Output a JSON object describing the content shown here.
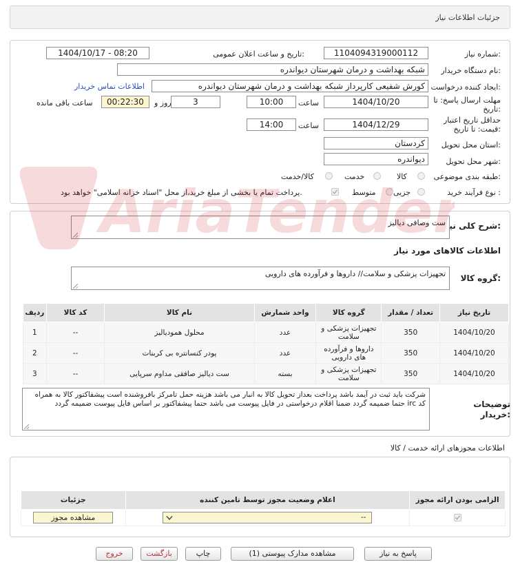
{
  "header": {
    "title": "جزئیات اطلاعات نیاز"
  },
  "form": {
    "need_number_label": "شماره نیاز:",
    "need_number": "1104094319000112",
    "announce_label": "تاریخ و ساعت اعلان عمومی:",
    "announce_value": "1404/10/17 - 08:20",
    "buyer_org_label": "نام دستگاه خریدار:",
    "buyer_org": "شبکه بهداشت و درمان شهرستان دیواندره",
    "requester_label": "ایجاد کننده درخواست:",
    "requester": "کورش شفیعی کارپرداز شبکه بهداشت و درمان شهرستان دیواندره",
    "contact_link": "اطلاعات تماس خریدار",
    "reply_deadline_label_1": "مهلت ارسال پاسخ: تا",
    "reply_deadline_label_2": "تاریخ:",
    "reply_date": "1404/10/20",
    "time_label": "ساعت",
    "reply_time": "10:00",
    "days_value": "3",
    "days_label": "روز و",
    "remaining_time": "00:22:30",
    "remaining_label": "ساعت باقی مانده",
    "price_validity_label_1": "حداقل تاریخ اعتبار",
    "price_validity_label_2": "قیمت: تا تاریخ:",
    "validity_date": "1404/12/29",
    "validity_time_label": "ساعت",
    "validity_time": "14:00",
    "province_label": "استان محل تحویل:",
    "province": "کردستان",
    "city_label": "شهر محل تحویل:",
    "city": "دیواندره",
    "category_label": "طبقه بندی موضوعی:",
    "category_options": [
      "کالا",
      "خدمت",
      "کالا/خدمت"
    ],
    "process_label": "نوع فرآیند خرید :",
    "process_options": [
      "جزیی",
      "متوسط"
    ],
    "payment_note": "پرداخت تمام یا بخشی از مبلغ خرید،از محل \"اسناد خزانه اسلامی\" خواهد بود."
  },
  "summary": {
    "label": "شرح کلی نیاز:",
    "value": "ست وصافی دیالیز"
  },
  "goods": {
    "section_title": "اطلاعات کالاهای مورد نیاز",
    "group_label": "گروه کالا:",
    "group_value": "تجهیزات پزشکی و سلامت// داروها و فرآورده های دارویی",
    "columns": [
      "ردیف",
      "کد کالا",
      "نام کالا",
      "واحد شمارش",
      "گروه کالا",
      "تعداد / مقدار",
      "تاریخ نیاز"
    ],
    "rows": [
      {
        "row": "1",
        "code": "--",
        "name": "محلول همودیالیز",
        "unit": "عدد",
        "group": "تجهیزات پزشکی و سلامت",
        "qty": "350",
        "date": "1404/10/20"
      },
      {
        "row": "2",
        "code": "--",
        "name": "پودر کنسانتره بی کربنات",
        "unit": "عدد",
        "group": "داروها و فرآورده های دارویی",
        "qty": "350",
        "date": "1404/10/20"
      },
      {
        "row": "3",
        "code": "--",
        "name": "ست دیالیز صافقی مداوم سرپایی",
        "unit": "بسته",
        "group": "تجهیزات پزشکی و سلامت",
        "qty": "350",
        "date": "1404/10/20"
      }
    ]
  },
  "buyer_notes": {
    "label": "توضیحات خریدار:",
    "value": "شرکت باید ثبت در آیمد باشد پرداخت بعداز تحویل کالا به انبار می باشد هزینه حمل تامرکز بافروشنده است پیشفاکتور کالا به همراه کد irc حتما ضمیمه گردد ضمنا اقلام درخواستی در فایل پیوست می باشد حتما پیشفاکتور بر اساس فایل پیوست ضمیمه گردد"
  },
  "permits": {
    "title": "اطلاعات مجوزهای ارائه خدمت / کالا",
    "columns": [
      "الزامی بودن ارائه مجوز",
      "اعلام وضعیت مجوز توسط تامین کننده",
      "جزئیات"
    ],
    "select_value": "--",
    "view_button": "مشاهده مجوز"
  },
  "actions": {
    "reply": "پاسخ به نیاز",
    "docs": "مشاهده مدارک پیوستی (1)",
    "print": "چاپ",
    "back": "بازگشت",
    "exit": "خروج"
  },
  "watermark": {
    "text": "AriaTender.neT"
  }
}
